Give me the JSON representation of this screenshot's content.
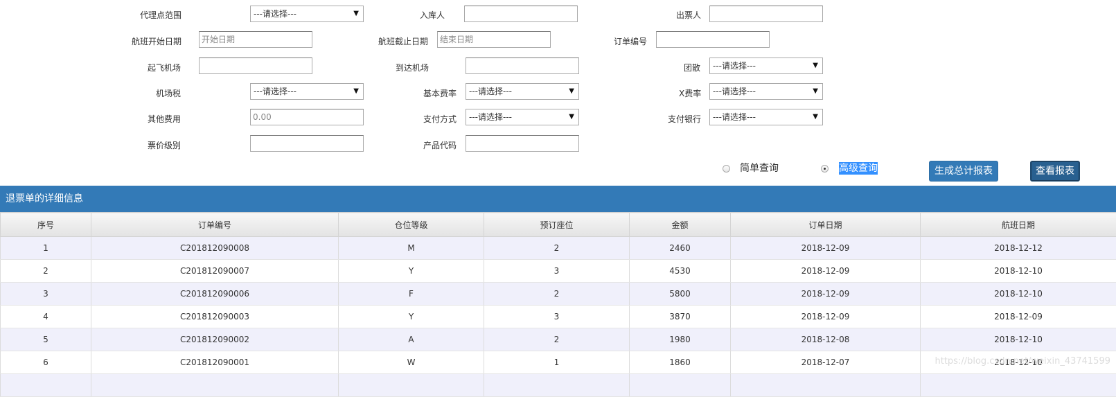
{
  "form": {
    "agent_range": {
      "label": "代理点范围",
      "value": "---请选择---"
    },
    "in_person": {
      "label": "入库人",
      "value": ""
    },
    "issuer": {
      "label": "出票人",
      "value": ""
    },
    "flight_start": {
      "label": "航班开始日期",
      "placeholder": "开始日期"
    },
    "flight_end": {
      "label": "航班截止日期",
      "placeholder": "结束日期"
    },
    "order_no": {
      "label": "订单编号",
      "value": ""
    },
    "departure_airport": {
      "label": "起飞机场",
      "value": ""
    },
    "arrival_airport": {
      "label": "到达机场",
      "value": ""
    },
    "group_scatter": {
      "label": "团散",
      "value": "---请选择---"
    },
    "airport_tax": {
      "label": "机场税",
      "value": "---请选择---"
    },
    "base_rate": {
      "label": "基本费率",
      "value": "---请选择---"
    },
    "x_rate": {
      "label": "X费率",
      "value": "---请选择---"
    },
    "other_fee": {
      "label": "其他费用",
      "placeholder": "0.00"
    },
    "pay_method": {
      "label": "支付方式",
      "value": "---请选择---"
    },
    "pay_bank": {
      "label": "支付银行",
      "value": "---请选择---"
    },
    "fare_level": {
      "label": "票价级别",
      "value": ""
    },
    "product_code": {
      "label": "产品代码",
      "value": ""
    }
  },
  "query_mode": {
    "simple": "简单查询",
    "advanced": "高级查询",
    "selected": "advanced"
  },
  "buttons": {
    "generate_total": "生成总计报表",
    "view_report": "查看报表"
  },
  "panel": {
    "title": "退票单的详细信息"
  },
  "table": {
    "headers": [
      "序号",
      "订单编号",
      "仓位等级",
      "预订座位",
      "金额",
      "订单日期",
      "航班日期"
    ],
    "rows": [
      [
        "1",
        "C201812090008",
        "M",
        "2",
        "2460",
        "2018-12-09",
        "2018-12-12"
      ],
      [
        "2",
        "C201812090007",
        "Y",
        "3",
        "4530",
        "2018-12-09",
        "2018-12-10"
      ],
      [
        "3",
        "C201812090006",
        "F",
        "2",
        "5800",
        "2018-12-09",
        "2018-12-10"
      ],
      [
        "4",
        "C201812090003",
        "Y",
        "3",
        "3870",
        "2018-12-09",
        "2018-12-09"
      ],
      [
        "5",
        "C201812090002",
        "A",
        "2",
        "1980",
        "2018-12-08",
        "2018-12-10"
      ],
      [
        "6",
        "C201812090001",
        "W",
        "1",
        "1860",
        "2018-12-07",
        "2018-12-10"
      ],
      [
        "",
        "",
        "",
        "",
        "",
        "",
        ""
      ]
    ]
  },
  "watermark": "https://blog.csdn.net/weixin_43741599"
}
